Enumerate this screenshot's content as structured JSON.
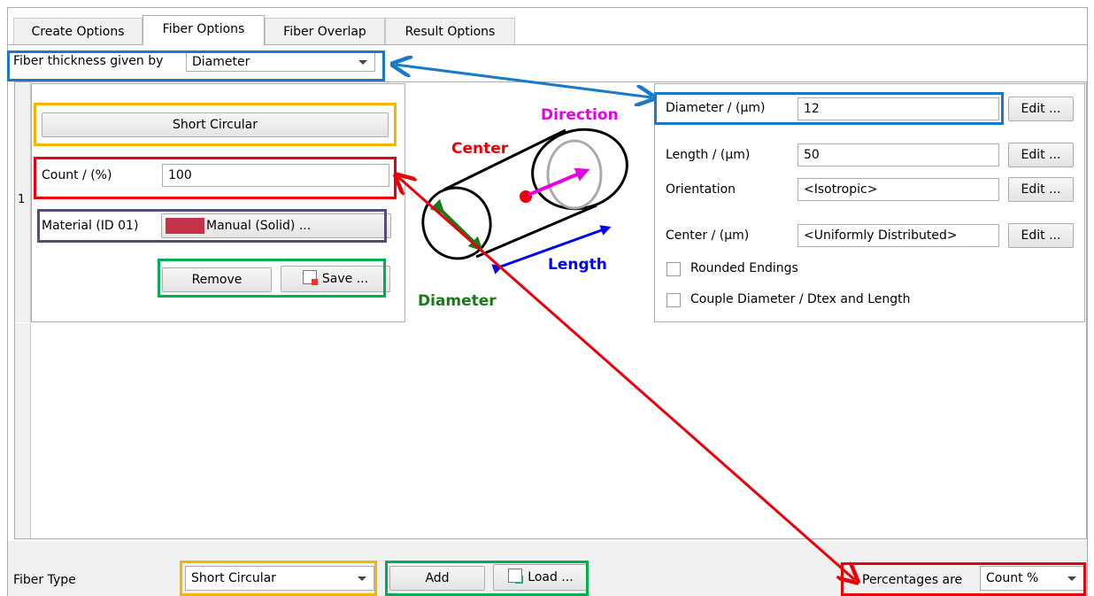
{
  "tabs": [
    {
      "label": "Create Options"
    },
    {
      "label": "Fiber Options",
      "active": true
    },
    {
      "label": "Fiber Overlap"
    },
    {
      "label": "Result Options"
    }
  ],
  "thickness": {
    "label": "Fiber thickness given by",
    "value": "Diameter"
  },
  "row_number": "1",
  "fiber_shape_button": "Short Circular",
  "count": {
    "label": "Count / (%)",
    "value": "100"
  },
  "material": {
    "label": "Material (ID 01)",
    "button": "Manual (Solid) ...",
    "swatch_color": "#c43247"
  },
  "remove_button": "Remove",
  "save_button": "Save ...",
  "diagram": {
    "direction": "Direction",
    "center": "Center",
    "length": "Length",
    "diameter": "Diameter"
  },
  "props": {
    "diameter": {
      "label": "Diameter / (µm)",
      "value": "12",
      "edit": "Edit ..."
    },
    "length": {
      "label": "Length / (µm)",
      "value": "50",
      "edit": "Edit ..."
    },
    "orientation": {
      "label": "Orientation",
      "value": "<Isotropic>",
      "edit": "Edit ..."
    },
    "center": {
      "label": "Center / (µm)",
      "value": "<Uniformly Distributed>",
      "edit": "Edit ..."
    },
    "rounded_endings": {
      "label": "Rounded Endings",
      "checked": false
    },
    "couple": {
      "label": "Couple Diameter / Dtex and Length",
      "checked": false
    }
  },
  "footer": {
    "fiber_type_label": "Fiber Type",
    "fiber_type_value": "Short Circular",
    "add_button": "Add",
    "load_button": "Load ...",
    "percentages_label": "Percentages are",
    "percentages_value": "Count %"
  },
  "colors": {
    "blue": "#1a7ac8",
    "orange": "#f5b400",
    "red": "#e8000b",
    "green": "#00b050",
    "purple": "#5a4a78",
    "diagram_red": "#e8000b",
    "diagram_magenta": "#e600e6",
    "diagram_blue": "#0000ff",
    "diagram_green": "#1a7a1a"
  }
}
